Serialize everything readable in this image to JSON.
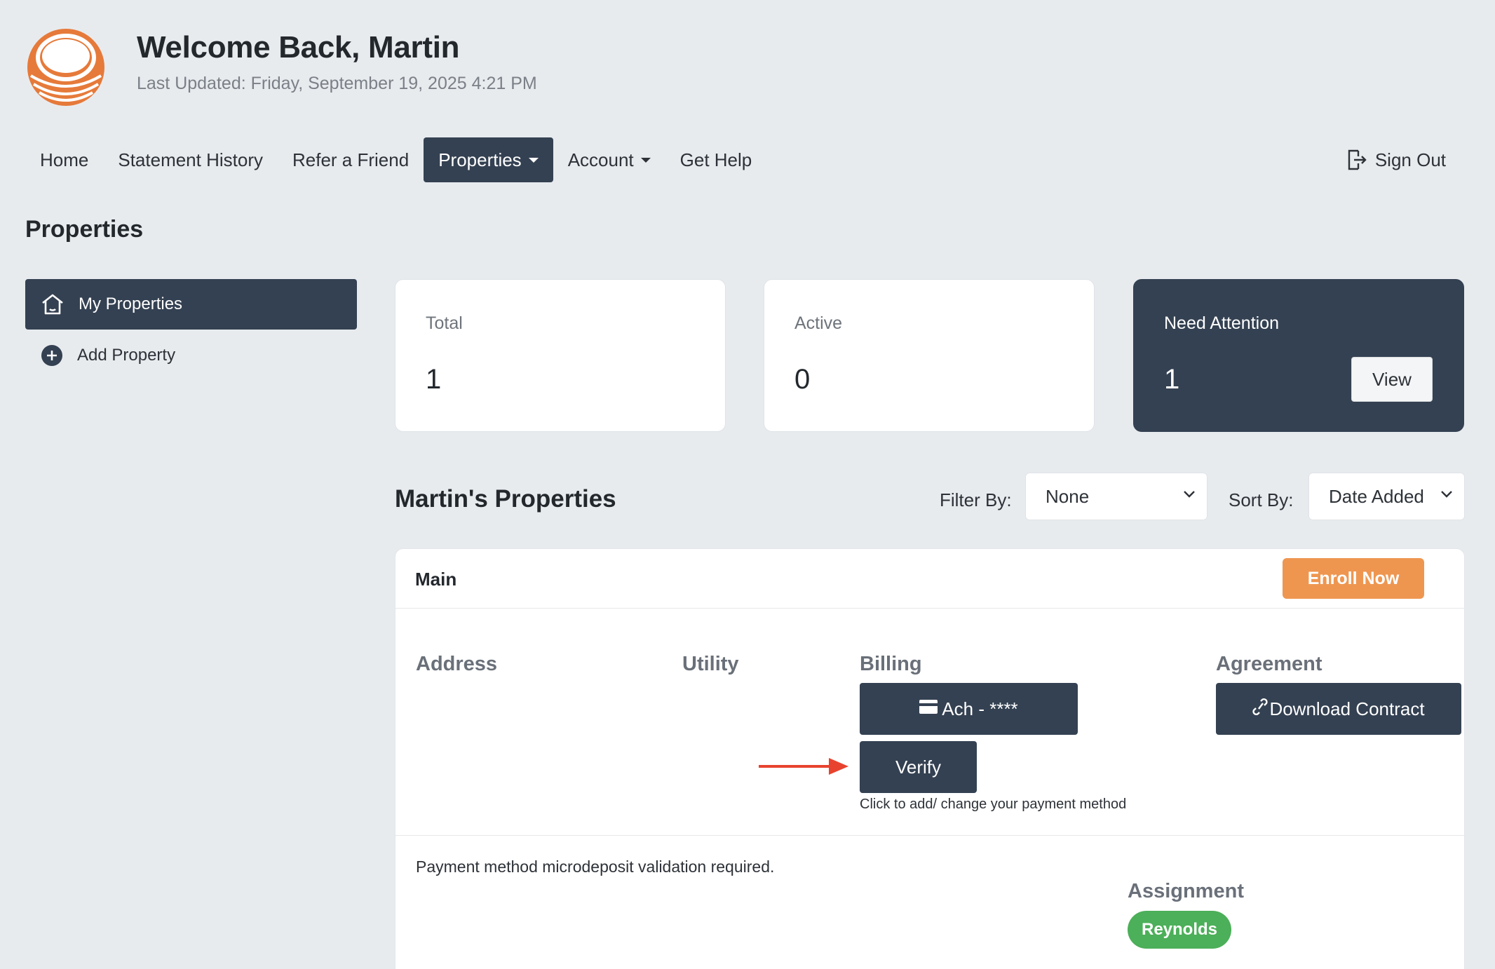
{
  "header": {
    "title": "Welcome Back, Martin",
    "last_updated": "Last Updated: Friday, September 19, 2025 4:21 PM",
    "logo_icon": "striped-circle-logo",
    "brand_color": "#e67a3a"
  },
  "nav": {
    "items": [
      {
        "label": "Home"
      },
      {
        "label": "Statement History"
      },
      {
        "label": "Refer a Friend"
      },
      {
        "label": "Properties",
        "active": true,
        "dropdown": true
      },
      {
        "label": "Account",
        "dropdown": true
      },
      {
        "label": "Get Help"
      }
    ],
    "sign_out": "Sign Out"
  },
  "page": {
    "title": "Properties"
  },
  "sidebar": {
    "items": [
      {
        "label": "My Properties",
        "icon": "home-icon",
        "active": true
      },
      {
        "label": "Add Property",
        "icon": "plus-circle-icon"
      }
    ]
  },
  "stats": {
    "total": {
      "label": "Total",
      "value": "1"
    },
    "active": {
      "label": "Active",
      "value": "0"
    },
    "attention": {
      "label": "Need Attention",
      "value": "1",
      "button": "View"
    }
  },
  "properties": {
    "title": "Martin's Properties",
    "filter_label": "Filter By:",
    "filter_value": "None",
    "sort_label": "Sort By:",
    "sort_value": "Date Added"
  },
  "card": {
    "name": "Main",
    "enroll": "Enroll Now",
    "columns": {
      "address": "Address",
      "utility": "Utility",
      "billing": "Billing",
      "agreement": "Agreement"
    },
    "billing_method": "Ach - ****",
    "verify": "Verify",
    "hint": "Click to add/ change your payment method",
    "download": "Download Contract",
    "message": "Payment method microdeposit validation required.",
    "assignment_label": "Assignment",
    "assignment_value": "Reynolds"
  },
  "colors": {
    "dark": "#344152",
    "accent_orange": "#ee9650",
    "success_green": "#4caf59",
    "arrow_red": "#e8432e"
  }
}
